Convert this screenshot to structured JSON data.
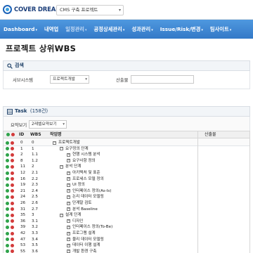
{
  "header": {
    "logo_text": "COVER DREAM IT",
    "project_select": "CMS 구축 프로젝트"
  },
  "nav": [
    {
      "label": "Dashboard",
      "caret": "▾",
      "dim": false
    },
    {
      "label": "내역업",
      "caret": "",
      "dim": false
    },
    {
      "label": "일정관리",
      "caret": "▾",
      "dim": true
    },
    {
      "label": "공정상세관리",
      "caret": "▾",
      "dim": false
    },
    {
      "label": "성과관리",
      "caret": "▾",
      "dim": false
    },
    {
      "label": "Issue/Risk/변경",
      "caret": "▾",
      "dim": false
    },
    {
      "label": "팀사이트",
      "caret": "▾",
      "dim": false
    }
  ],
  "page_title": "프로젝트 상위WBS",
  "search": {
    "heading": "검색",
    "system_label": "서브시스템",
    "system_value": "프로젝트개발",
    "output_label": "산출물",
    "output_value": ""
  },
  "task": {
    "heading": "Task",
    "count": "(158건)",
    "view_label": "요약보기",
    "view_value": "2레벨요약보기"
  },
  "grid": {
    "columns": {
      "id": "ID",
      "wbs": "WBS",
      "name": "작업명",
      "output": "산출물"
    },
    "rows": [
      {
        "id": "0",
        "wbs": "0",
        "name": "프로젝트개발",
        "level": 0,
        "toggle": "−"
      },
      {
        "id": "1",
        "wbs": "1",
        "name": "요구정의 단계",
        "level": 1,
        "toggle": "−"
      },
      {
        "id": "2",
        "wbs": "1.1",
        "name": "현행 시스템 분석",
        "level": 2,
        "toggle": "+"
      },
      {
        "id": "8",
        "wbs": "1.2",
        "name": "요구사항 정의",
        "level": 2,
        "toggle": "+"
      },
      {
        "id": "11",
        "wbs": "2",
        "name": "분석 단계",
        "level": 1,
        "toggle": "−"
      },
      {
        "id": "12",
        "wbs": "2.1",
        "name": "아키텍처 및 표준",
        "level": 2,
        "toggle": "+"
      },
      {
        "id": "16",
        "wbs": "2.2",
        "name": "프로세스 모델 정의",
        "level": 2,
        "toggle": "+"
      },
      {
        "id": "19",
        "wbs": "2.3",
        "name": "UI 정의",
        "level": 2,
        "toggle": "+"
      },
      {
        "id": "21",
        "wbs": "2.4",
        "name": "인터페이스 정의(As-Is)",
        "level": 2,
        "toggle": "+"
      },
      {
        "id": "24",
        "wbs": "2.5",
        "name": "논리 데이터 모델링",
        "level": 2,
        "toggle": "+"
      },
      {
        "id": "26",
        "wbs": "2.6",
        "name": "단계말 검토",
        "level": 2,
        "toggle": "+"
      },
      {
        "id": "31",
        "wbs": "2.7",
        "name": "분석 Baseline",
        "level": 2,
        "toggle": "+"
      },
      {
        "id": "35",
        "wbs": "3",
        "name": "설계 단계",
        "level": 1,
        "toggle": "−"
      },
      {
        "id": "36",
        "wbs": "3.1",
        "name": "디자인",
        "level": 2,
        "toggle": "+"
      },
      {
        "id": "39",
        "wbs": "3.2",
        "name": "인터페이스 정의(To-Be)",
        "level": 2,
        "toggle": "+"
      },
      {
        "id": "42",
        "wbs": "3.3",
        "name": "프로그램 설계",
        "level": 2,
        "toggle": "+"
      },
      {
        "id": "47",
        "wbs": "3.4",
        "name": "물리 데이터 모델링",
        "level": 2,
        "toggle": "+"
      },
      {
        "id": "53",
        "wbs": "3.5",
        "name": "데이터 이행 설계",
        "level": 2,
        "toggle": "+"
      },
      {
        "id": "55",
        "wbs": "3.6",
        "name": "개발 환경 구축",
        "level": 2,
        "toggle": "+"
      }
    ]
  },
  "colors": {
    "nav": "#3f88d4",
    "add": "#2fa34a",
    "remove": "#d33b3b"
  }
}
